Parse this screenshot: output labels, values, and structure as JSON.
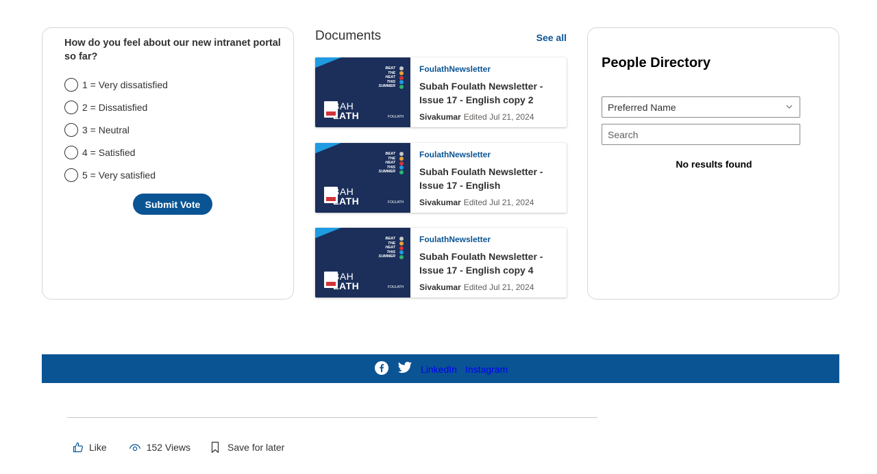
{
  "poll": {
    "question": "How do you feel about our new intranet portal so far?",
    "options": [
      "1 = Very dissatisfied",
      "2 = Dissatisfied",
      "3 = Neutral",
      "4 = Satisfied",
      "5 = Very satisfied"
    ],
    "submit_label": "Submit Vote"
  },
  "documents": {
    "title": "Documents",
    "see_all": "See all",
    "thumbnail": {
      "beat_lines": [
        "BEAT",
        "THE",
        "HEAT",
        "THIS",
        "SUMMER"
      ],
      "brand_top": "BAH",
      "brand_bottom": "LATH",
      "logo_text": "FOULATH"
    },
    "items": [
      {
        "source": "FoulathNewsletter",
        "title": "Subah Foulath Newsletter - Issue 17 - English copy 2",
        "author": "Sivakumar",
        "edited": "Edited Jul 21, 2024"
      },
      {
        "source": "FoulathNewsletter",
        "title": "Subah Foulath Newsletter - Issue 17 - English",
        "author": "Sivakumar",
        "edited": "Edited Jul 21, 2024"
      },
      {
        "source": "FoulathNewsletter",
        "title": "Subah Foulath Newsletter - Issue 17 - English copy 4",
        "author": "Sivakumar",
        "edited": "Edited Jul 21, 2024"
      }
    ]
  },
  "people": {
    "title": "People Directory",
    "select_value": "Preferred Name",
    "search_placeholder": "Search",
    "no_results": "No results found"
  },
  "footer": {
    "linkedin": "LinkedIn",
    "instagram": "Instagram",
    "bar_color": "#0a5494"
  },
  "actions": {
    "like": "Like",
    "views": "152 Views",
    "save": "Save for later"
  }
}
